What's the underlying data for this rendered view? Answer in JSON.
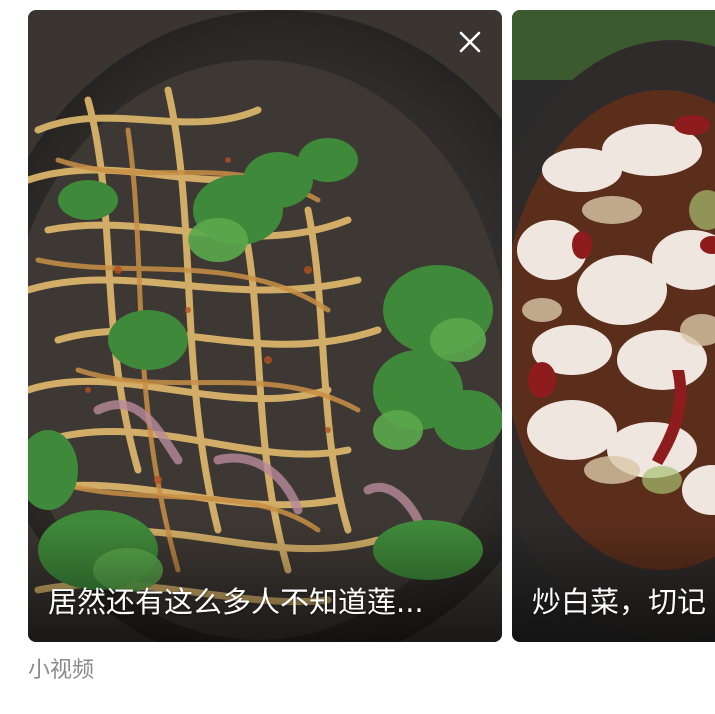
{
  "videos": [
    {
      "title": "居然还有这么多人不知道莲...",
      "thumbnail_icon": "noodle-salad-image"
    },
    {
      "title": "炒白菜，切记",
      "thumbnail_icon": "cabbage-dish-image"
    }
  ],
  "close_icon": "close-icon",
  "section": {
    "label": "小视频"
  },
  "colors": {
    "caption_text": "#ffffff",
    "section_label": "#8a8a8a",
    "background": "#ffffff"
  }
}
